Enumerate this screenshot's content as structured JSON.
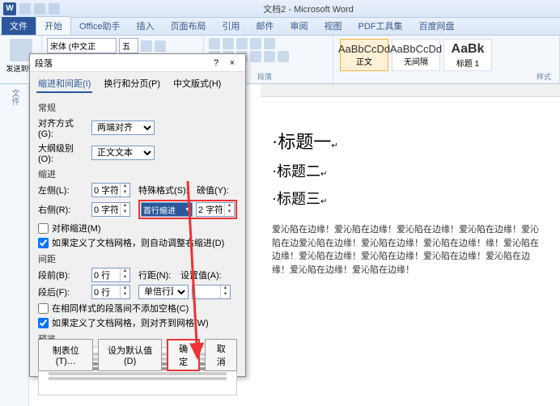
{
  "app_title": "文档2 - Microsoft Word",
  "ribbon_tabs": {
    "file": "文件",
    "home": "开始",
    "office_helper": "Office助手",
    "insert": "插入",
    "layout": "页面布局",
    "references": "引用",
    "mailings": "邮件",
    "review": "审阅",
    "view": "视图",
    "pdf": "PDF工具集",
    "baidu": "百度网盘"
  },
  "ribbon": {
    "font_name": "宋体 (中文正",
    "font_size": "五",
    "paragraph_label": "段落",
    "styles_label": "样式",
    "styles": [
      {
        "sample": "AaBbCcDd",
        "name": "正文"
      },
      {
        "sample": "AaBbCcDd",
        "name": "无间隔"
      },
      {
        "sample": "AaBk",
        "name": "标题 1"
      }
    ]
  },
  "left_panel": {
    "clipboard": "发送到微",
    "file": "文件"
  },
  "dialog": {
    "title": "段落",
    "help": "?",
    "close": "×",
    "tabs": {
      "t1": "缩进和间距(I)",
      "t2": "换行和分页(P)",
      "t3": "中文版式(H)"
    },
    "general": "常规",
    "align_label": "对齐方式(G):",
    "align_value": "两端对齐",
    "outline_label": "大纲级别(O):",
    "outline_value": "正文文本",
    "indent": "缩进",
    "left_label": "左侧(L):",
    "left_value": "0 字符",
    "right_label": "右侧(R):",
    "right_value": "0 字符",
    "special_label": "特殊格式(S):",
    "special_value": "首行缩进",
    "measure_label": "磅值(Y):",
    "measure_value": "2 字符",
    "mirror": "对称缩进(M)",
    "auto_indent": "如果定义了文档网格，则自动调整右缩进(D)",
    "spacing": "间距",
    "before_label": "段前(B):",
    "before_value": "0 行",
    "after_label": "段后(F):",
    "after_value": "0 行",
    "line_label": "行距(N):",
    "line_value": "单倍行距",
    "at_label": "设置值(A):",
    "at_value": "",
    "no_space": "在相同样式的段落间不添加空格(C)",
    "snap_grid": "如果定义了文档网格，则对齐到网格(W)",
    "preview": "预览",
    "tabs_btn": "制表位(T)…",
    "default_btn": "设为默认值(D)",
    "ok": "确定",
    "cancel": "取消"
  },
  "doc": {
    "h1": "标题一",
    "h2": "标题二",
    "h3": "标题三",
    "para": "爱沁陷在边缘！爱沁陷在边缘！爱沁陷在边缘！爱沁陷在边缘！爱沁陷在边爱沁陷在边缘！爱沁陷在边缘！爱沁陷在边缘！缘！爱沁陷在边缘！爱沁陷在边缘！爱沁陷在边缘！爱沁陷在边缘！爱沁陷在边缘！爱沁陷在边缘！爱沁陷在边缘！"
  }
}
